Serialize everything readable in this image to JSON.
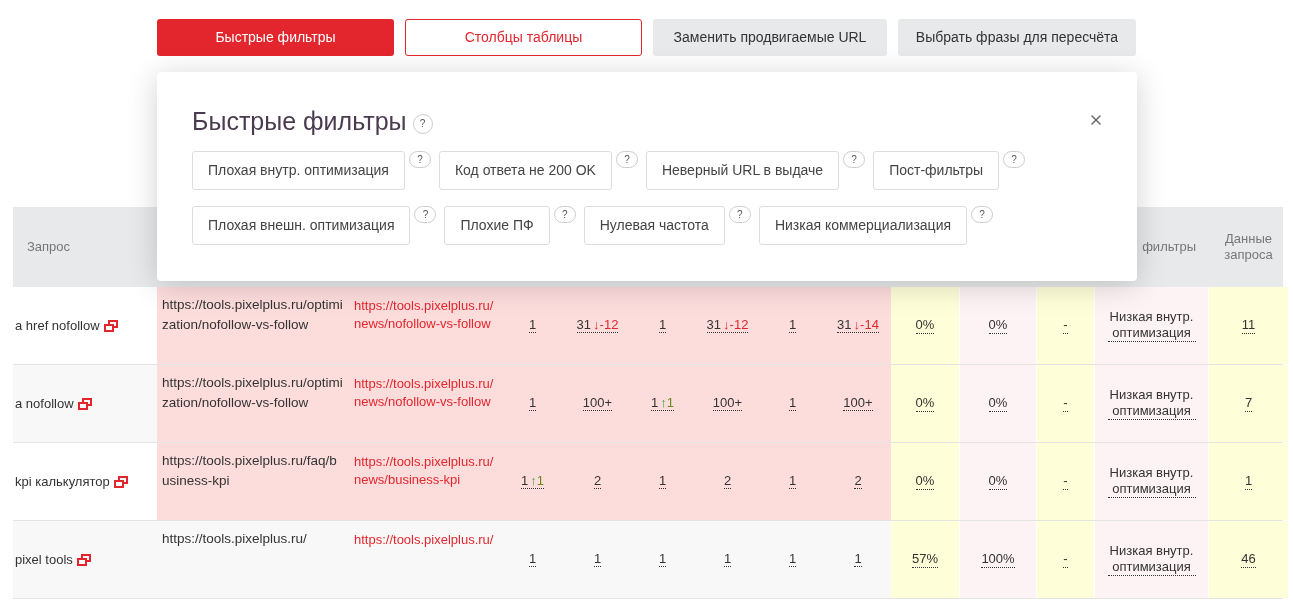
{
  "toolbar": [
    {
      "label": "Быстрые фильтры",
      "kind": "primary"
    },
    {
      "label": "Столбцы таблицы",
      "kind": "outline"
    },
    {
      "label": "Заменить продвигаемые URL",
      "kind": "plain"
    },
    {
      "label": "Выбрать фразы для пересчёта",
      "kind": "plain"
    }
  ],
  "popup": {
    "title": "Быстрые фильтры",
    "title_help": "?",
    "filter_rows": [
      [
        {
          "label": "Плохая внутр. оптимизация",
          "help": "?"
        },
        {
          "label": "Код ответа не 200 OK",
          "help": "?"
        },
        {
          "label": "Неверный URL в выдаче",
          "help": "?"
        },
        {
          "label": "Пост-фильтры",
          "help": "?"
        }
      ],
      [
        {
          "label": "Плохая внешн. оптимизация",
          "help": "?"
        },
        {
          "label": "Плохие ПФ",
          "help": "?"
        },
        {
          "label": "Нулевая частота",
          "help": "?"
        },
        {
          "label": "Низкая коммерциализация",
          "help": "?"
        }
      ]
    ]
  },
  "table": {
    "header": {
      "query": "Запрос",
      "filters": "фильтры",
      "data": "Данные запроса"
    },
    "rows": [
      {
        "query": "a href nofollow",
        "highlighted": true,
        "target_url": "https://tools.pixelplus.ru/optimization/nofollow-vs-follow",
        "found_url": "https://tools.pixelplus.ru/news/nofollow-vs-follow",
        "positions": [
          {
            "value": "1"
          },
          {
            "value": "31",
            "kind": "fall",
            "arrow": "↓",
            "change": "-12"
          },
          {
            "value": "1"
          },
          {
            "value": "31",
            "kind": "fall",
            "arrow": "↓",
            "change": "-12"
          },
          {
            "value": "1"
          },
          {
            "value": "31",
            "kind": "fall",
            "arrow": "↓",
            "change": "-14"
          }
        ],
        "column_10": "0%",
        "column_11": "0%",
        "column_12": "-",
        "filter": "Низкая внутр. оптимизация",
        "data": "11"
      },
      {
        "query": "a nofollow",
        "highlighted": true,
        "target_url": "https://tools.pixelplus.ru/optimization/nofollow-vs-follow",
        "found_url": "https://tools.pixelplus.ru/news/nofollow-vs-follow",
        "positions": [
          {
            "value": "1"
          },
          {
            "value": "100+"
          },
          {
            "value": "1",
            "kind": "rise",
            "arrow": "↑",
            "change": "1"
          },
          {
            "value": "100+"
          },
          {
            "value": "1"
          },
          {
            "value": "100+"
          }
        ],
        "column_10": "0%",
        "column_11": "0%",
        "column_12": "-",
        "filter": "Низкая внутр. оптимизация",
        "data": "7"
      },
      {
        "query": "kpi калькулятор",
        "highlighted": true,
        "target_url": "https://tools.pixelplus.ru/faq/business-kpi",
        "found_url": "https://tools.pixelplus.ru/news/business-kpi",
        "positions": [
          {
            "value": "1",
            "kind": "rise",
            "arrow": "↑",
            "change": "1"
          },
          {
            "value": "2"
          },
          {
            "value": "1"
          },
          {
            "value": "2"
          },
          {
            "value": "1"
          },
          {
            "value": "2"
          }
        ],
        "column_10": "0%",
        "column_11": "0%",
        "column_12": "-",
        "filter": "Низкая внутр. оптимизация",
        "data": "1"
      },
      {
        "query": "pixel tools",
        "highlighted": false,
        "target_url": "https://tools.pixelplus.ru/",
        "found_url": "https://tools.pixelplus.ru/",
        "positions": [
          {
            "value": "1"
          },
          {
            "value": "1"
          },
          {
            "value": "1"
          },
          {
            "value": "1"
          },
          {
            "value": "1"
          },
          {
            "value": "1"
          }
        ],
        "column_10": "57%",
        "column_11": "100%",
        "column_12": "-",
        "filter": "Низкая внутр. оптимизация",
        "data": "46"
      }
    ]
  }
}
